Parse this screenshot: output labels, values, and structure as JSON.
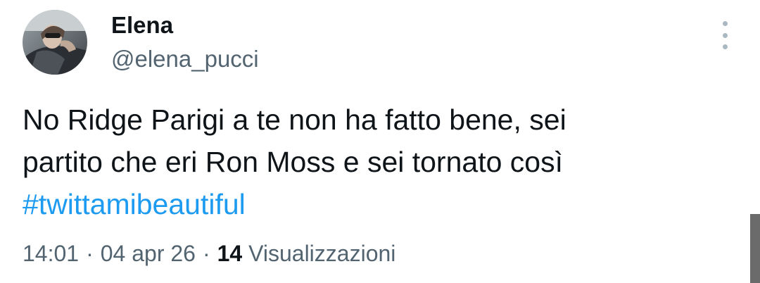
{
  "author": {
    "display_name": "Elena",
    "handle": "@elena_pucci",
    "avatar_icon": "profile-photo"
  },
  "more_icon": "vertical-ellipsis-icon",
  "tweet": {
    "lines": [
      "No Ridge Parigi a te non ha fatto bene, sei",
      "partito che eri Ron Moss e sei tornato così"
    ],
    "hashtag": "#twittamibeautiful"
  },
  "meta": {
    "time": "14:01",
    "separator": "·",
    "date": "04 apr 26",
    "views_count": "14",
    "views_label": "Visualizzazioni"
  },
  "colors": {
    "text": "#0f1419",
    "secondary": "#536471",
    "link": "#1d9bf0"
  }
}
